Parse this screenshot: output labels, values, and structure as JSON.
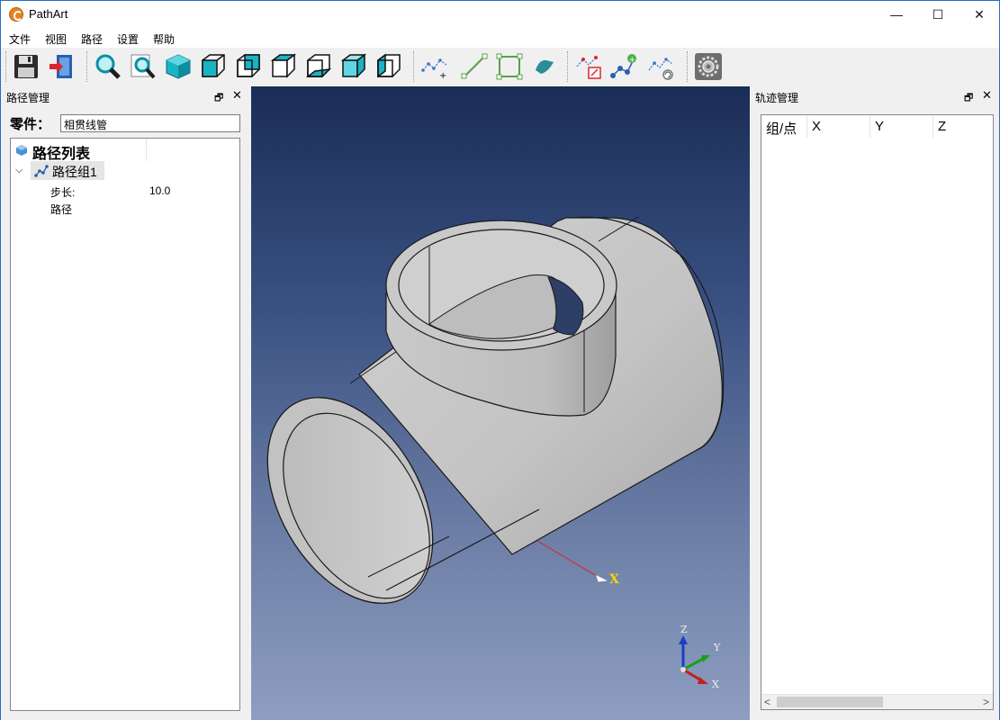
{
  "app": {
    "title": "PathArt"
  },
  "window_controls": {
    "minimize": "—",
    "maximize": "☐",
    "close": "✕"
  },
  "menu": [
    "文件",
    "视图",
    "路径",
    "设置",
    "帮助"
  ],
  "left_panel": {
    "title": "路径管理",
    "part_label": "零件：",
    "part_value": "相贯线管",
    "tree": {
      "root": "路径列表",
      "group": {
        "label": "路径组1",
        "props": [
          {
            "name": "步长:",
            "value": "10.0"
          },
          {
            "name": "路径",
            "value": ""
          }
        ]
      }
    }
  },
  "right_panel": {
    "title": "轨迹管理",
    "columns": [
      "组/点",
      "X",
      "Y",
      "Z"
    ]
  },
  "viewport": {
    "axis_x": "X",
    "triad": {
      "x": "X",
      "y": "Y",
      "z": "Z"
    }
  },
  "colors": {
    "accent": "#2b6dc2",
    "cyan_icon": "#1ab3c4",
    "pipe": "#c8c8c8"
  },
  "toolbar_icons": [
    "save-icon",
    "exit-icon",
    "zoom-fit-icon",
    "zoom-window-icon",
    "view-iso-icon",
    "view-front-icon",
    "view-back-icon",
    "view-top-icon",
    "view-bottom-icon",
    "view-left-icon",
    "view-right-icon",
    "add-point-icon",
    "line-icon",
    "rectangle-icon",
    "surface-icon",
    "edit-path-icon",
    "add-node-icon",
    "refresh-path-icon",
    "settings-icon"
  ]
}
